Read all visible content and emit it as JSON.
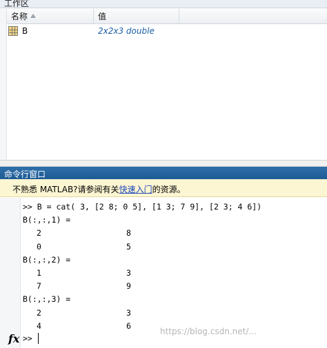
{
  "workspace": {
    "title": "工作区",
    "columns": {
      "name": "名称",
      "value": "值"
    },
    "variables": [
      {
        "name": "B",
        "value": "2x2x3 double"
      }
    ]
  },
  "command_window": {
    "title": "命令行窗口",
    "notice": {
      "prefix": "不熟悉 MATLAB?请参阅有关",
      "link": "快速入门",
      "suffix": "的资源。"
    },
    "input_line": ">> B = cat( 3, [2 8; 0 5], [1 3; 7 9], [2 3; 4 6])",
    "outputs": [
      {
        "label": "B(:,:,1) =",
        "rows": [
          [
            "2",
            "8"
          ],
          [
            "0",
            "5"
          ]
        ]
      },
      {
        "label": "B(:,:,2) =",
        "rows": [
          [
            "1",
            "3"
          ],
          [
            "7",
            "9"
          ]
        ]
      },
      {
        "label": "B(:,:,3) =",
        "rows": [
          [
            "2",
            "3"
          ],
          [
            "4",
            "6"
          ]
        ]
      }
    ],
    "prompt": ">>",
    "fx": "fx"
  },
  "watermark": "https://blog.csdn.net/..."
}
